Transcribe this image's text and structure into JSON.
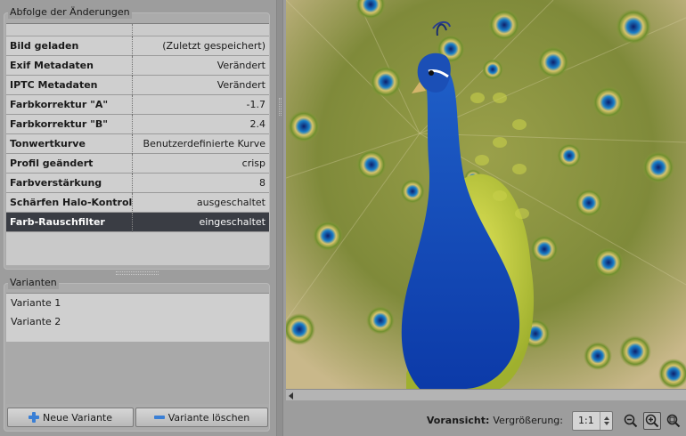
{
  "history": {
    "title": "Abfolge der Änderungen",
    "rows": [
      {
        "name": "Bild geladen",
        "value": "(Zuletzt gespeichert)"
      },
      {
        "name": "Exif Metadaten",
        "value": "Verändert"
      },
      {
        "name": "IPTC Metadaten",
        "value": "Verändert"
      },
      {
        "name": "Farbkorrektur \"A\"",
        "value": "-1.7"
      },
      {
        "name": "Farbkorrektur \"B\"",
        "value": "2.4"
      },
      {
        "name": "Tonwertkurve",
        "value": "Benutzerdefinierte Kurve"
      },
      {
        "name": "Profil geändert",
        "value": "crisp"
      },
      {
        "name": "Farbverstärkung",
        "value": "8"
      },
      {
        "name": "Schärfen Halo-Kontrolle",
        "value": "ausgeschaltet"
      },
      {
        "name": "Farb-Rauschfilter",
        "value": "eingeschaltet"
      }
    ],
    "selected_index": 9
  },
  "variants": {
    "title": "Varianten",
    "items": [
      "Variante 1",
      "Variante 2"
    ],
    "new_label": "Neue Variante",
    "delete_label": "Variante löschen"
  },
  "statusbar": {
    "preview_label": "Voransicht:",
    "zoom_label": "Vergrößerung:",
    "zoom_value": "1:1"
  },
  "colors": {
    "selected_row": "#3a3d44",
    "accent_icon": "#3a7fd5"
  }
}
